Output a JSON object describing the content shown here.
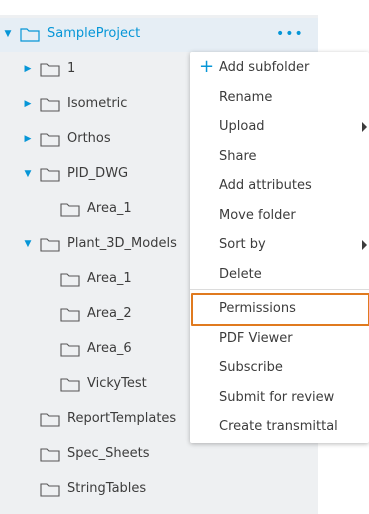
{
  "tree": {
    "root": {
      "label": "SampleProject",
      "more_icon": "more-horizontal-icon"
    },
    "items": [
      {
        "label": "1"
      },
      {
        "label": "Isometric"
      },
      {
        "label": "Orthos"
      },
      {
        "label": "PID_DWG"
      },
      {
        "label": "Area_1"
      },
      {
        "label": "Plant_3D_Models"
      },
      {
        "label": "Area_1"
      },
      {
        "label": "Area_2"
      },
      {
        "label": "Area_6"
      },
      {
        "label": "VickyTest"
      },
      {
        "label": "ReportTemplates"
      },
      {
        "label": "Spec_Sheets"
      },
      {
        "label": "StringTables"
      }
    ]
  },
  "menu": {
    "items": [
      {
        "label": "Add subfolder",
        "icon": "plus-icon"
      },
      {
        "label": "Rename"
      },
      {
        "label": "Upload",
        "submenu": true
      },
      {
        "label": "Share"
      },
      {
        "label": "Add attributes"
      },
      {
        "label": "Move folder"
      },
      {
        "label": "Sort by",
        "submenu": true
      },
      {
        "label": "Delete"
      },
      {
        "label": "Permissions",
        "highlighted": true
      },
      {
        "label": "PDF Viewer"
      },
      {
        "label": "Subscribe"
      },
      {
        "label": "Submit for review"
      },
      {
        "label": "Create transmittal"
      }
    ]
  },
  "colors": {
    "accent": "#0696d7",
    "highlight": "#e07a1f"
  }
}
